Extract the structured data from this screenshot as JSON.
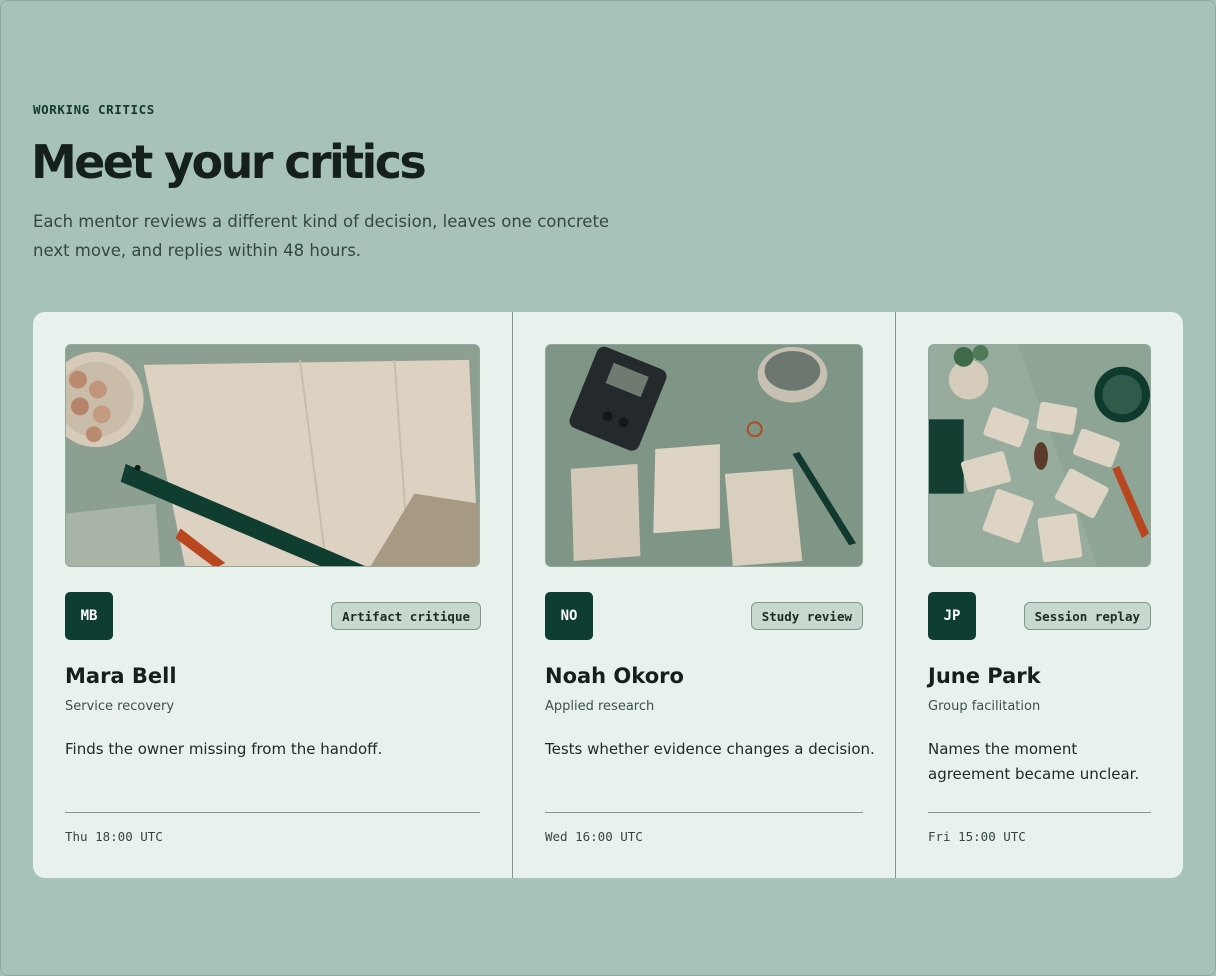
{
  "header": {
    "eyebrow": "WORKING CRITICS",
    "title": "Meet your critics",
    "intro": "Each mentor reviews a different kind of decision, leaves one concrete next move, and replies within 48 hours."
  },
  "colors": {
    "background": "#a7c2b6",
    "panel": "#e8f1ec",
    "avatar": "#0e3e31",
    "tag_bg": "#c8d8cf"
  },
  "critics": [
    {
      "initials": "MB",
      "tag": "Artifact critique",
      "name": "Mara Bell",
      "role": "Service recovery",
      "description": "Finds the owner missing from the handoff.",
      "time": "Thu 18:00 UTC"
    },
    {
      "initials": "NO",
      "tag": "Study review",
      "name": "Noah Okoro",
      "role": "Applied research",
      "description": "Tests whether evidence changes a decision.",
      "time": "Wed 16:00 UTC"
    },
    {
      "initials": "JP",
      "tag": "Session replay",
      "name": "June Park",
      "role": "Group facilitation",
      "description": "Names the moment agreement became unclear.",
      "time": "Fri 15:00 UTC"
    }
  ]
}
